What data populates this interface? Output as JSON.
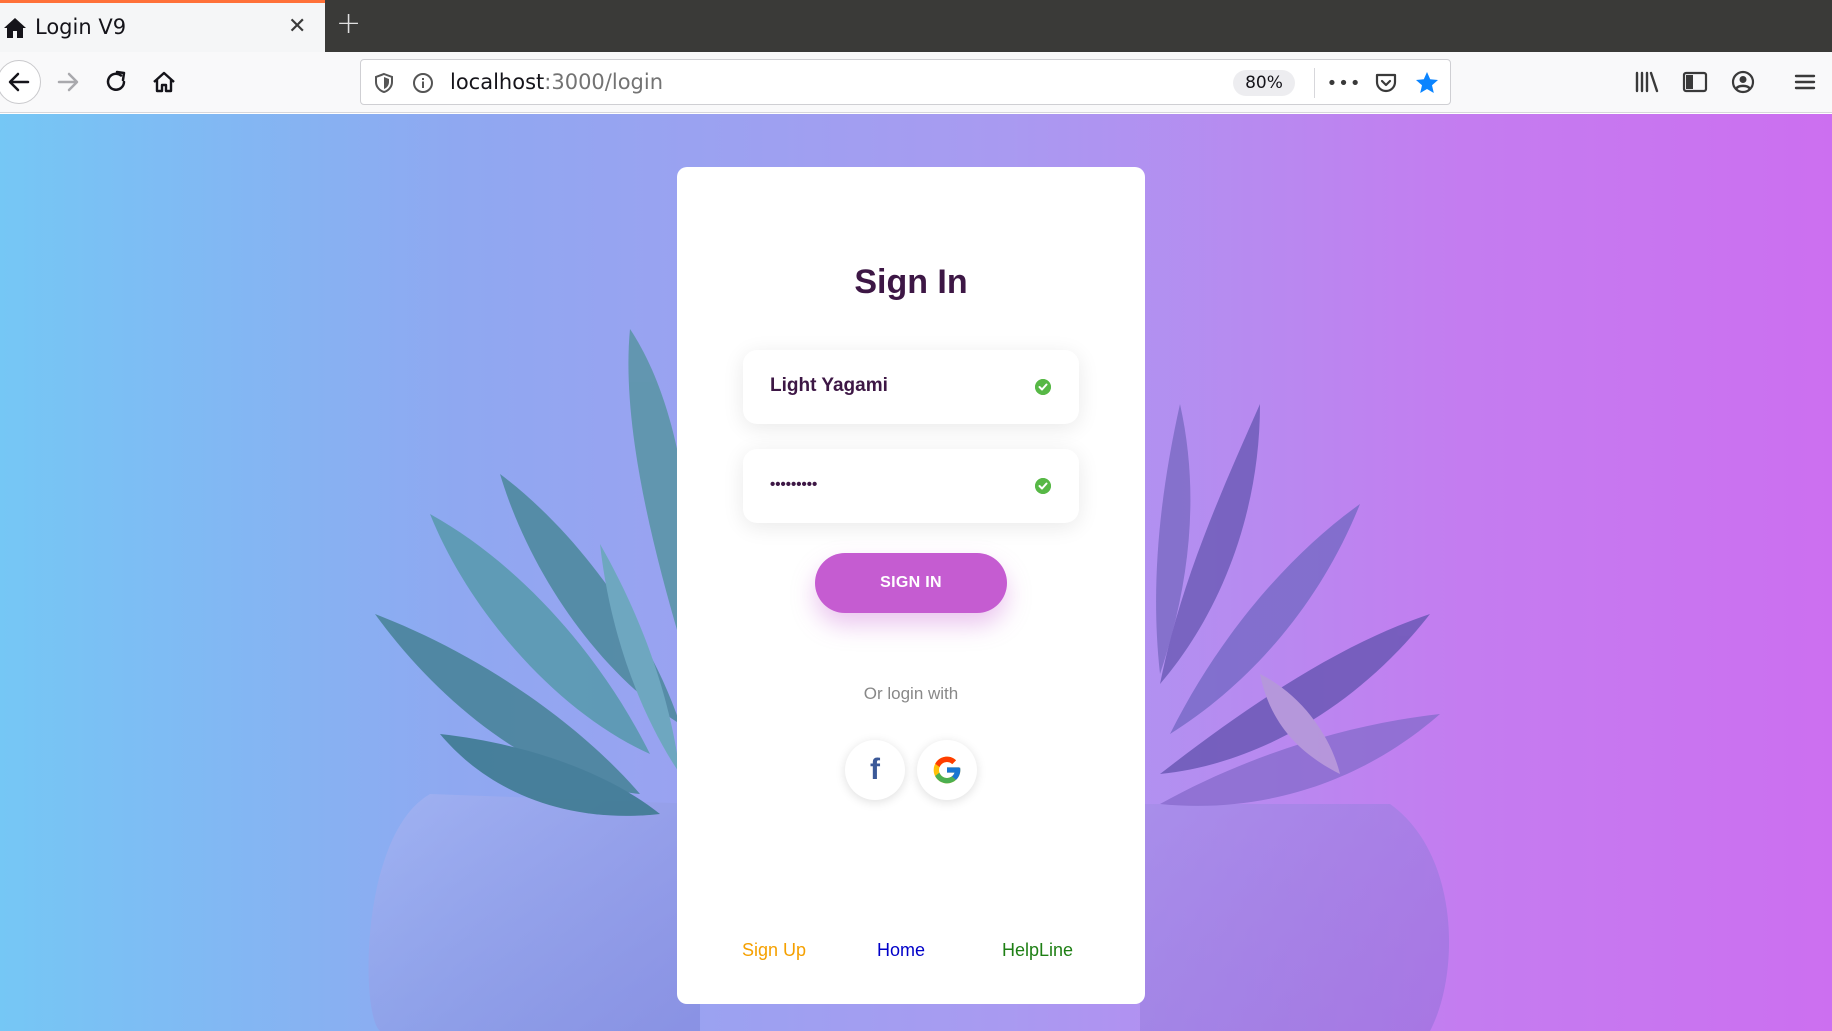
{
  "browser": {
    "tab": {
      "title": "Login V9",
      "close": "✕"
    },
    "new_tab": "+",
    "url": {
      "host": "localhost",
      "path": ":3000/login"
    },
    "zoom": "80%",
    "more": "•••"
  },
  "login": {
    "title": "Sign In",
    "username": "Light Yagami",
    "password_mask": "•••••••••",
    "submit_label": "SIGN IN",
    "alt_login_label": "Or login with",
    "facebook_glyph": "f",
    "footer": {
      "signup": "Sign Up",
      "home": "Home",
      "helpline": "HelpLine"
    }
  },
  "colors": {
    "accent": "#c55cd1",
    "title": "#3d1745",
    "valid": "#57b846",
    "signup_link": "#f5a000",
    "home_link": "#0000c8",
    "helpline_link": "#1e7f14",
    "facebook": "#3b5998"
  }
}
